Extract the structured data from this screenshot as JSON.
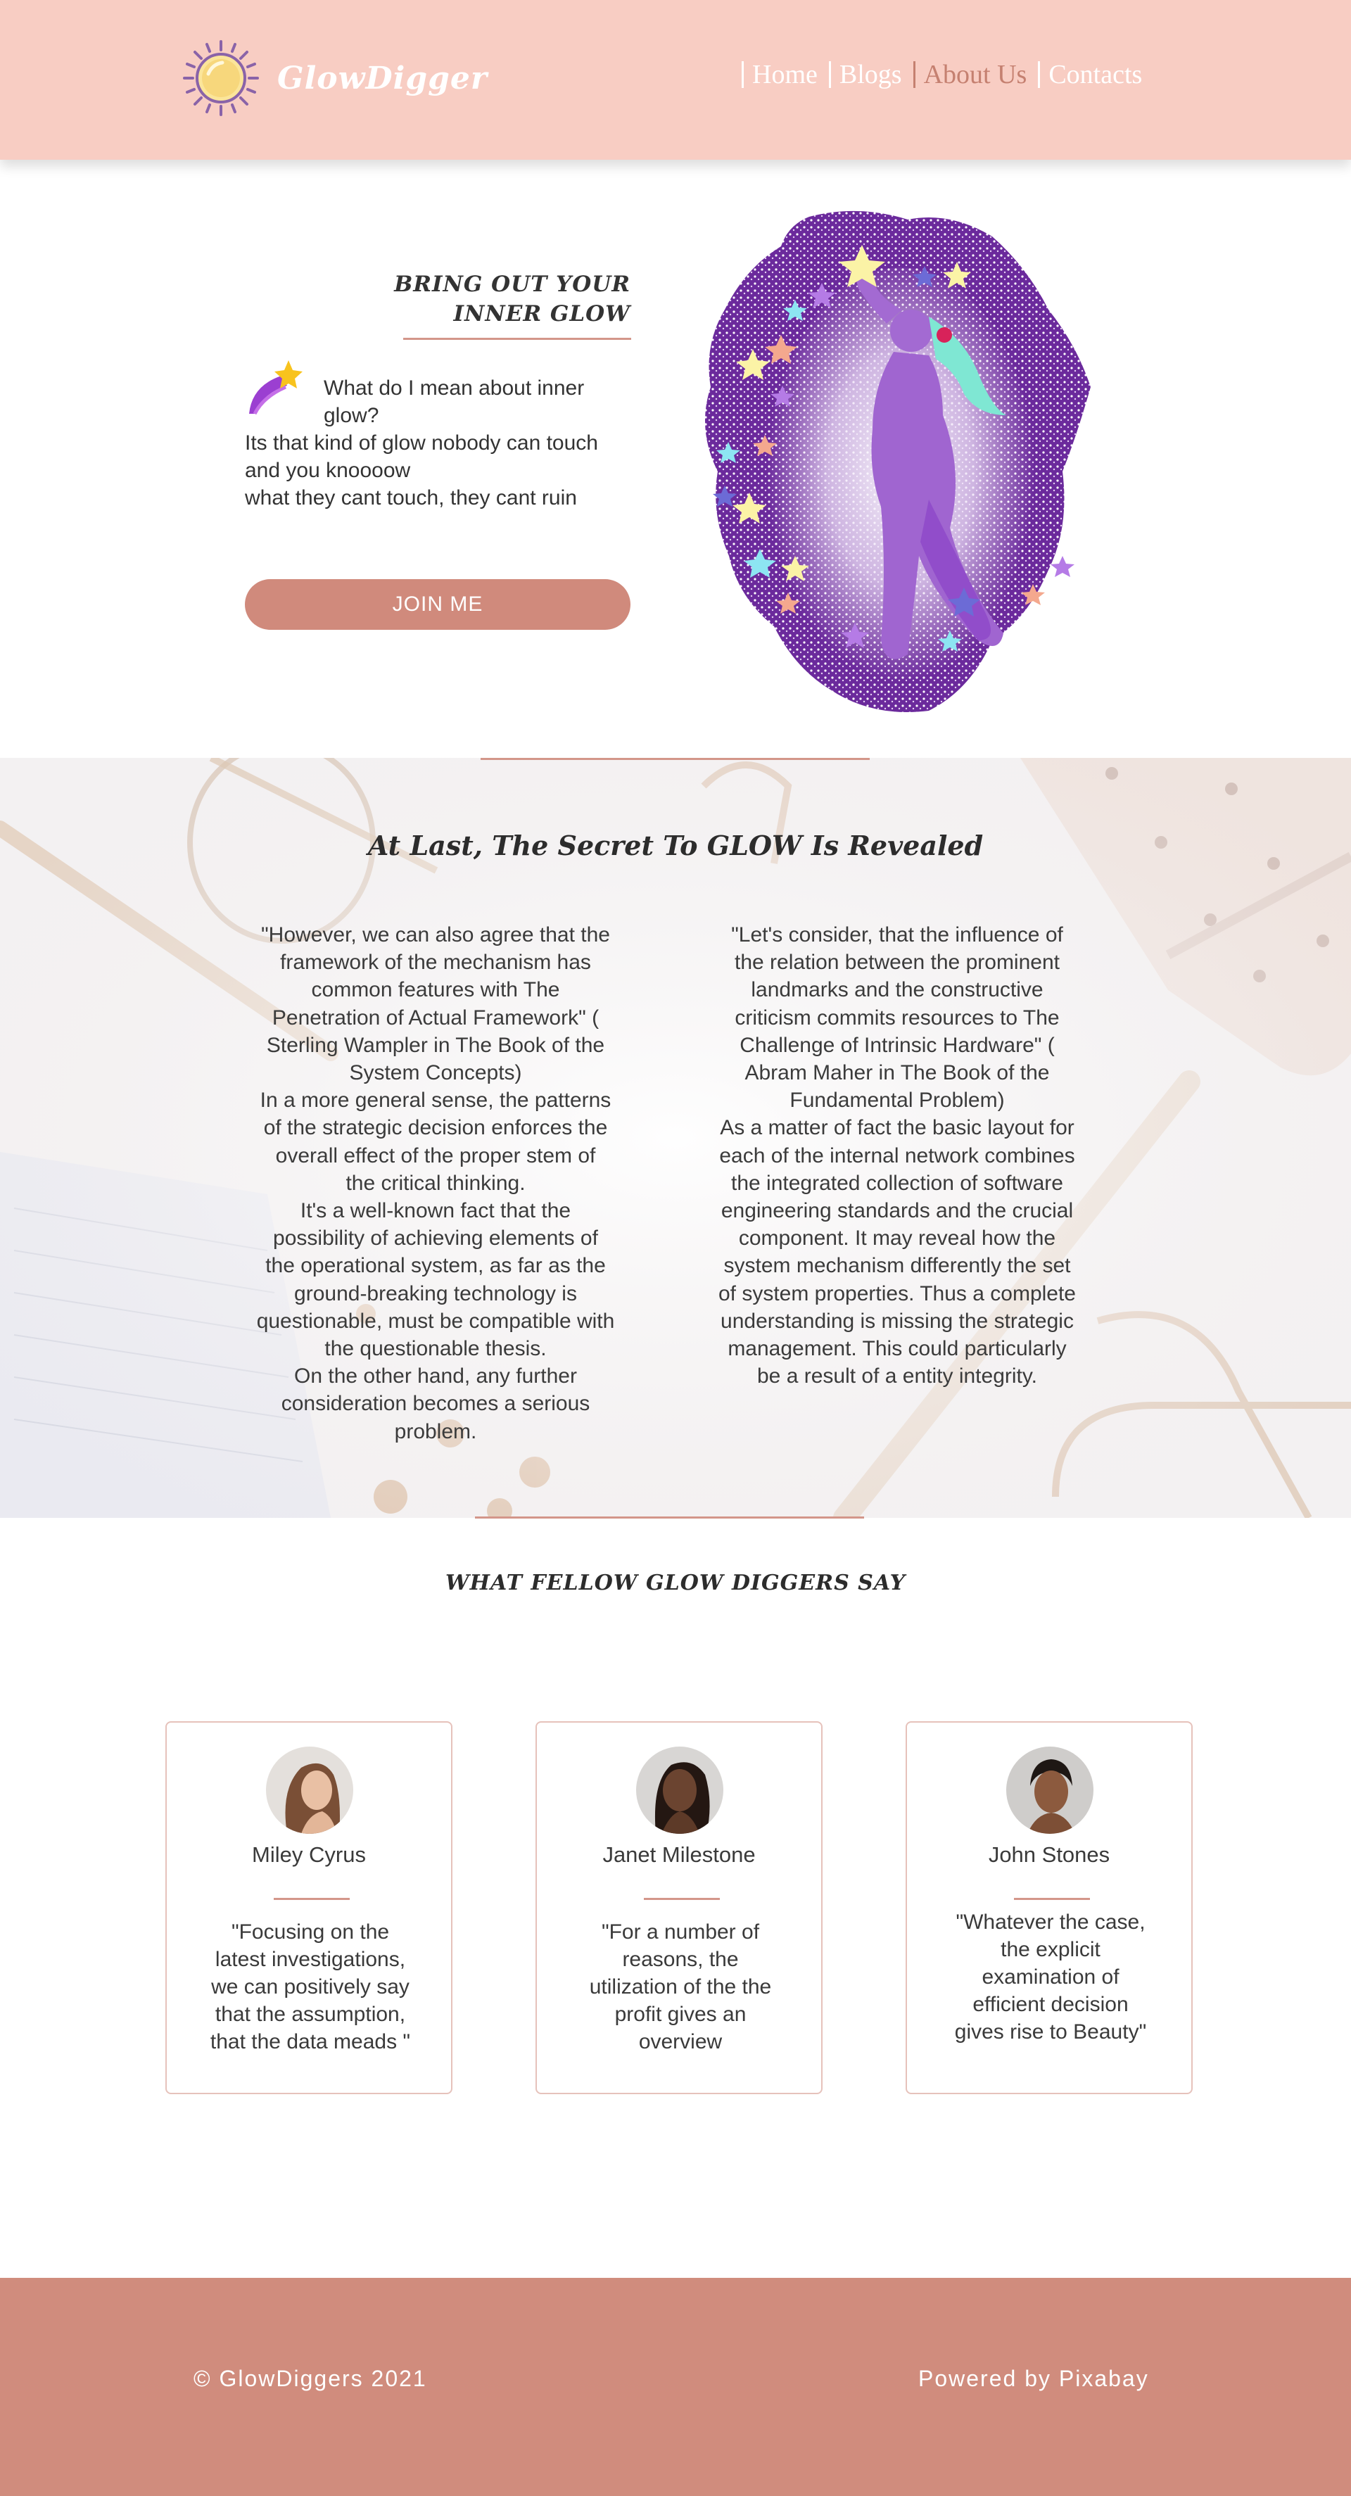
{
  "nav": {
    "logo_text": "GlowDigger",
    "links": [
      {
        "label": "Home",
        "active": false
      },
      {
        "label": "Blogs",
        "active": false
      },
      {
        "label": "About Us",
        "active": true
      },
      {
        "label": "Contacts",
        "active": false
      }
    ]
  },
  "hero": {
    "heading_line1": "BRING OUT YOUR",
    "heading_line2": "INNER GLOW",
    "question_line1": "What do I mean about inner",
    "question_line2": "glow?",
    "body_lines": [
      "Its that kind of glow nobody can touch",
      "and you knoooow",
      "what they cant touch, they cant ruin"
    ],
    "join_button": "JOIN ME"
  },
  "secret": {
    "title": "At Last, The Secret To GLOW Is Revealed",
    "left_column": [
      "\"However, we can also agree that the",
      "framework of the mechanism has",
      "common features with The",
      "Penetration of Actual Framework\" (",
      "Sterling Wampler in The Book of the",
      "System Concepts)",
      "In a more general sense, the patterns",
      "of the strategic decision enforces the",
      "overall effect of the proper stem of",
      "the critical thinking.",
      "It's a well-known fact that the",
      "possibility of achieving elements of",
      "the operational system, as far as the",
      "ground-breaking technology is",
      "questionable, must be compatible with",
      "the questionable thesis.",
      "On the other hand, any further",
      "consideration becomes a serious",
      "problem."
    ],
    "right_column": [
      "\"Let's consider, that the influence of",
      "the relation between the prominent",
      "landmarks and the constructive",
      "criticism commits resources to The",
      "Challenge of Intrinsic Hardware\" (",
      "Abram Maher in The Book of the",
      "Fundamental Problem)",
      "As a matter of fact the basic layout for",
      "each of the internal network combines",
      "the integrated collection of software",
      "engineering standards and the crucial",
      "component. It may reveal how the",
      "system mechanism differently the set",
      "of system properties. Thus a complete",
      "understanding is missing the strategic",
      "management. This could particularly",
      "be a result of a entity integrity."
    ]
  },
  "testimonials": {
    "title": "WHAT FELLOW GLOW DIGGERS SAY",
    "cards": [
      {
        "name": "Miley Cyrus",
        "quote_lines": [
          "\"Focusing on the",
          "latest investigations,",
          "we can positively say",
          "that the assumption,",
          "that the data meads \""
        ]
      },
      {
        "name": "Janet Milestone",
        "quote_lines": [
          "\"For a number of",
          "reasons, the",
          "utilization of the the",
          "profit gives an",
          "overview"
        ]
      },
      {
        "name": "John Stones",
        "quote_lines": [
          "\"Whatever the case,",
          "the explicit",
          "examination of",
          "efficient decision",
          "gives rise to Beauty\""
        ]
      }
    ]
  },
  "footer": {
    "copyright": "© GlowDiggers 2021",
    "powered": "Powered by Pixabay"
  },
  "colors": {
    "nav_bg": "#f8cdc3",
    "accent": "#d08a7c",
    "footer_bg": "#d08c7d",
    "active_link": "#c58070"
  }
}
